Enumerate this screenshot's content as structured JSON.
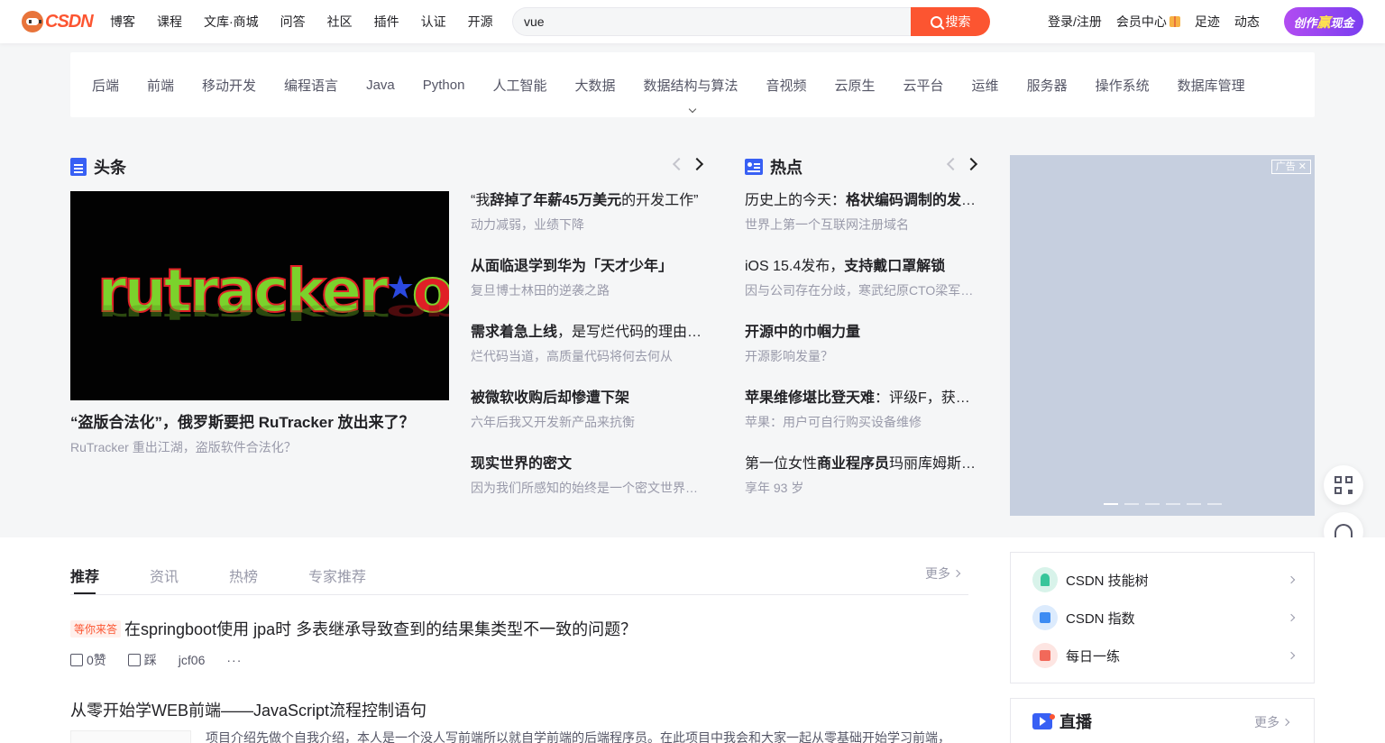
{
  "header": {
    "logo_text": "CSDN",
    "nav": [
      "博客",
      "课程",
      "文库·商城",
      "问答",
      "社区",
      "插件",
      "认证",
      "开源"
    ],
    "search_value": "vue",
    "search_button": "搜索",
    "right_links": [
      "登录/注册",
      "会员中心",
      "足迹",
      "动态"
    ],
    "create_part1": "创作",
    "create_part2": "赢",
    "create_part3": "现金"
  },
  "categories": [
    "后端",
    "前端",
    "移动开发",
    "编程语言",
    "Java",
    "Python",
    "人工智能",
    "大数据",
    "数据结构与算法",
    "音视频",
    "云原生",
    "云平台",
    "运维",
    "服务器",
    "操作系统",
    "数据库管理"
  ],
  "headlines": {
    "title": "头条",
    "image_logo_green": "rutracker",
    "image_logo_red": "org",
    "feature_title": "“盗版合法化”，俄罗斯要把 RuTracker 放出来了？",
    "feature_sub": "RuTracker 重出江湖，盗版软件合法化？",
    "items": [
      {
        "pre": "“我",
        "bold": "辞掉了年薪45万美元",
        "post": "的开发工作”",
        "sub": "动力减弱，业绩下降"
      },
      {
        "pre": "",
        "bold": "从面临退学到华为「天才少年」",
        "post": "",
        "sub": "复旦博士林田的逆袭之路"
      },
      {
        "pre": "",
        "bold": "需求着急上线",
        "post": "，是写烂代码的理由吗？",
        "sub": "烂代码当道，高质量代码将何去何从"
      },
      {
        "pre": "",
        "bold": "被微软收购后却惨遭下架",
        "post": "",
        "sub": "六年后我又开发新产品来抗衡"
      },
      {
        "pre": "",
        "bold": "现实世界的密文",
        "post": "",
        "sub": "因为我们所感知的始终是一个密文世界，而不是明文世界"
      }
    ]
  },
  "hot": {
    "title": "热点",
    "items": [
      {
        "pre": "历史上的今天：",
        "bold": "格状编码调制的发明者",
        "post": "",
        "sub": "世界上第一个互联网注册域名"
      },
      {
        "pre": "iOS 15.4发布，",
        "bold": "支持戴口罩解锁",
        "post": "",
        "sub": "因与公司存在分歧，寒武纪原CTO梁军离职"
      },
      {
        "pre": "",
        "bold": "开源中的巾帼力量",
        "post": "",
        "sub": "开源影响发量？"
      },
      {
        "pre": "",
        "bold": "苹果维修堪比登天难",
        "post": "：评级F，获得最差评价",
        "sub": "苹果：用户可自行购买设备维修"
      },
      {
        "pre": "第一位女性",
        "bold": "商业程序员",
        "post": "玛丽库姆斯逝世",
        "sub": "享年 93 岁"
      }
    ]
  },
  "ad": {
    "tag": "广告",
    "close": "✕",
    "slide_count": 6,
    "active_slide": 1
  },
  "feed": {
    "tabs": [
      "推荐",
      "资讯",
      "热榜",
      "专家推荐"
    ],
    "active_tab": "推荐",
    "more": "更多",
    "post1": {
      "badge": "等你来答",
      "title": "在springboot使用 jpa时 多表继承导致查到的结果集类型不一致的问题？",
      "likes": "0赞",
      "dislike": "踩",
      "author": "jcf06",
      "more": "···"
    },
    "post2": {
      "title": "从零开始学WEB前端——JavaScript流程控制语句",
      "desc": "项目介绍先做个自我介绍，本人是一个没人写前端所以就自学前端的后端程序员。在此项目中我会和大家一起从零基础开始学习前端，"
    }
  },
  "sidebar": {
    "links": [
      "CSDN 技能树",
      "CSDN 指数",
      "每日一练"
    ],
    "live_title": "直播",
    "live_more": "更多"
  }
}
